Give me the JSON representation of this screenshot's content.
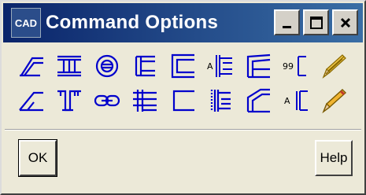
{
  "window": {
    "title": "Command Options",
    "icon_text": "CAD",
    "controls": [
      "minimize-icon",
      "maximize-icon",
      "close-icon"
    ]
  },
  "toolbar": {
    "row1": [
      {
        "icon": "angled-parallel-lines-icon"
      },
      {
        "icon": "column-section-icon"
      },
      {
        "icon": "circle-pipe-icon"
      },
      {
        "icon": "parallel-lines-icon"
      },
      {
        "icon": "offset-rectangle-icon"
      },
      {
        "icon": "labeled-dimension-A-icon",
        "label": "A"
      },
      {
        "icon": "corner-lines-icon"
      },
      {
        "icon": "numbered-dimension-icon",
        "label": "99"
      },
      {
        "icon": "pencil-striped-icon"
      }
    ],
    "row2": [
      {
        "icon": "angled-offset-icon"
      },
      {
        "icon": "channel-section-icon"
      },
      {
        "icon": "link-chain-icon"
      },
      {
        "icon": "center-parallel-lines-icon"
      },
      {
        "icon": "corner-bracket-icon"
      },
      {
        "icon": "double-bracket-icon"
      },
      {
        "icon": "angled-corner-icon"
      },
      {
        "icon": "labeled-bracket-A-icon",
        "label": "A"
      },
      {
        "icon": "pencil-icon"
      }
    ]
  },
  "buttons": {
    "ok": "OK",
    "help": "Help"
  },
  "colors": {
    "accent": "#0000cc",
    "titlebar": "#0a246a",
    "face": "#ece9d8"
  }
}
